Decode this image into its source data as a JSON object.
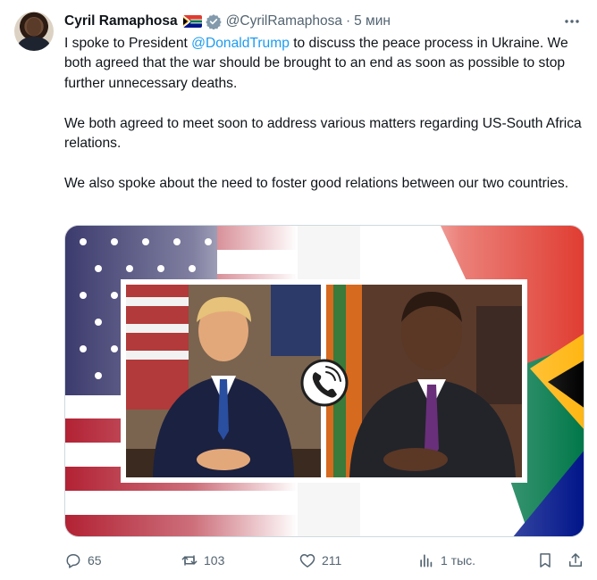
{
  "author": {
    "name": "Cyril Ramaphosa",
    "handle": "@CyrilRamaphosa",
    "separator": "·",
    "time": "5 мин",
    "flag_icon": "south-africa-flag-icon",
    "verified_icon": "verified-badge-icon"
  },
  "tweet": {
    "line1_prefix": "I spoke to President ",
    "mention": "@DonaldTrump",
    "line1_suffix": " to discuss the peace process in Ukraine. We both agreed that the war should be brought to an end as soon as possible to stop further unnecessary deaths.",
    "paragraph2": "We both agreed to meet soon to address various matters regarding US-South Africa relations.",
    "paragraph3": "We also spoke about the need to foster good relations between our two countries."
  },
  "media": {
    "icon": "phone-call-icon"
  },
  "actions": {
    "replies": "65",
    "reposts": "103",
    "likes": "211",
    "views": "1 тыс."
  },
  "colors": {
    "accent": "#1d9bf0",
    "secondary_text": "#536471",
    "text": "#0f1419"
  }
}
